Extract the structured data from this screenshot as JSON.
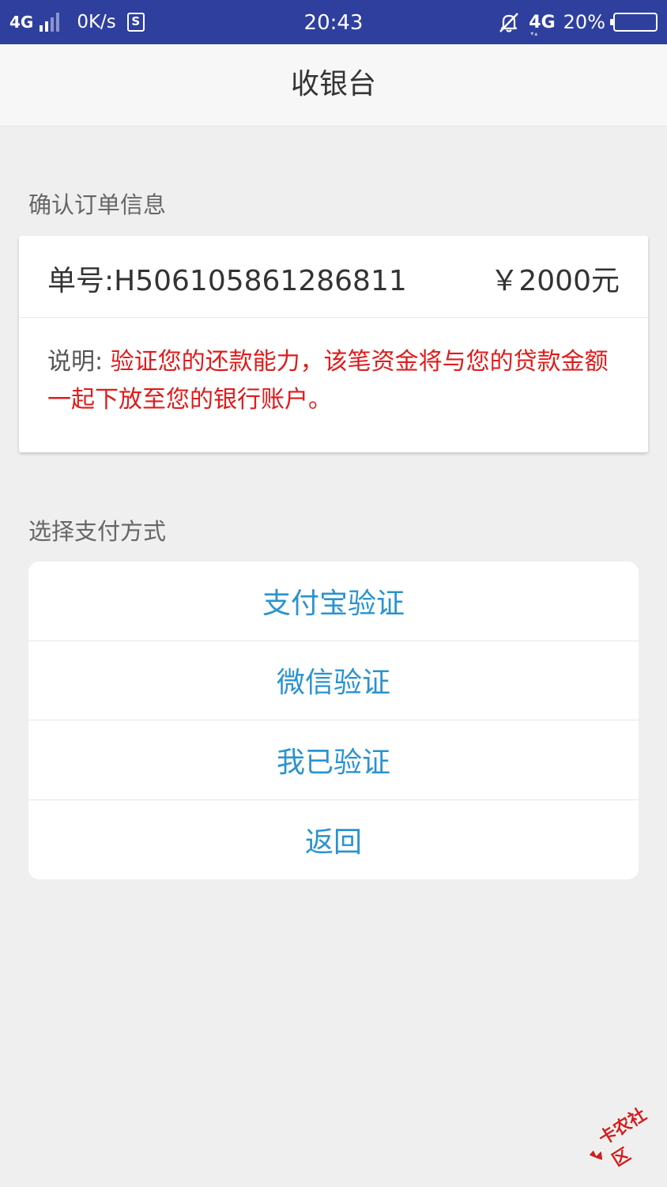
{
  "status_bar": {
    "network_left": "4G",
    "speed": "0K/s",
    "sim_label": "S",
    "time": "20:43",
    "network_right": "4G",
    "battery_text": "20%",
    "battery_level": 0.2,
    "icons": [
      "signal-icon",
      "sim-icon",
      "bell-off-icon",
      "battery-icon"
    ]
  },
  "header": {
    "title": "收银台"
  },
  "order_section": {
    "label": "确认订单信息",
    "order_number": "单号:H506105861286811",
    "amount": "￥2000元",
    "desc_label": "说明: ",
    "desc_text": "验证您的还款能力，该笔资金将与您的贷款金额一起下放至您的银行账户。"
  },
  "pay_section": {
    "label": "选择支付方式",
    "options": [
      {
        "label": "支付宝验证"
      },
      {
        "label": "微信验证"
      },
      {
        "label": "我已验证"
      },
      {
        "label": "返回"
      }
    ]
  },
  "watermark": {
    "text": "卡农社区"
  },
  "colors": {
    "status_bar": "#2f3f9e",
    "option_text": "#2a93cf",
    "warning_text": "#e01b1b",
    "background": "#efefef"
  }
}
